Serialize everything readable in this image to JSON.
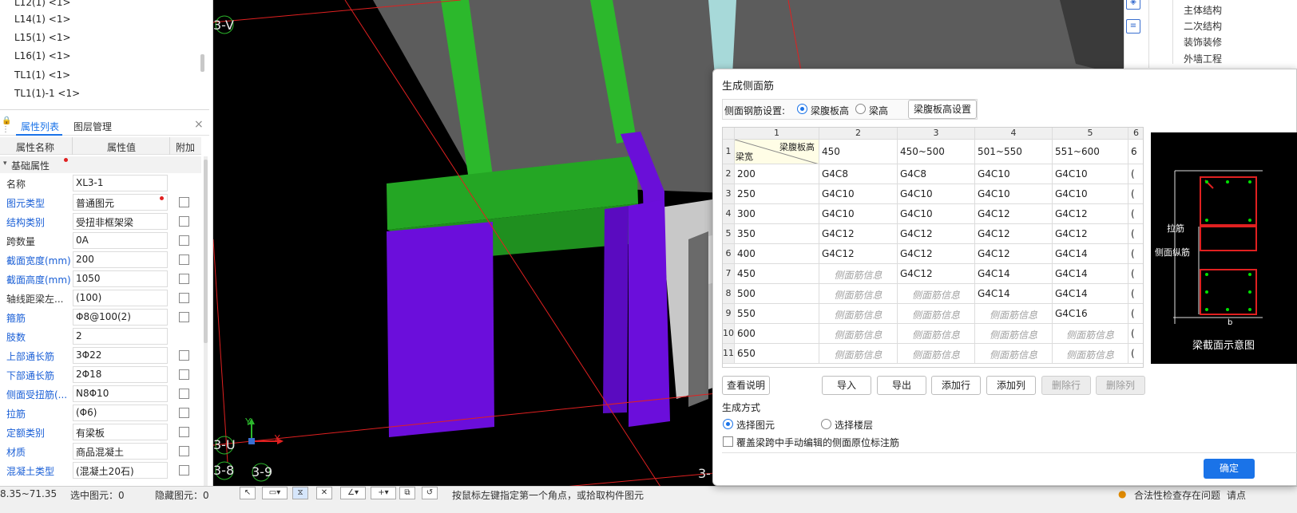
{
  "tree": {
    "items": [
      "L12(1) <1>",
      "L14(1) <1>",
      "L15(1) <1>",
      "L16(1) <1>",
      "TL1(1) <1>",
      "TL1(1)-1 <1>"
    ]
  },
  "props": {
    "tab_list": "属性列表",
    "tab_layers": "图层管理",
    "close": "×",
    "headers": {
      "name": "属性名称",
      "value": "属性值",
      "extra": "附加"
    },
    "group": "基础属性",
    "rows": [
      {
        "name": "名称",
        "value": "XL3-1",
        "blue": false,
        "check": false
      },
      {
        "name": "图元类型",
        "value": "普通图元",
        "blue": true,
        "check": true,
        "dot": true
      },
      {
        "name": "结构类别",
        "value": "受扭非框架梁",
        "blue": true,
        "check": true
      },
      {
        "name": "跨数量",
        "value": "0A",
        "blue": false,
        "check": true
      },
      {
        "name": "截面宽度(mm)",
        "value": "200",
        "blue": true,
        "check": true
      },
      {
        "name": "截面高度(mm)",
        "value": "1050",
        "blue": true,
        "check": true
      },
      {
        "name": "轴线距梁左...",
        "value": "(100)",
        "blue": false,
        "check": true
      },
      {
        "name": "箍筋",
        "value": "Φ8@100(2)",
        "blue": true,
        "check": true
      },
      {
        "name": "肢数",
        "value": "2",
        "blue": true,
        "check": false
      },
      {
        "name": "上部通长筋",
        "value": "3Φ22",
        "blue": true,
        "check": true
      },
      {
        "name": "下部通长筋",
        "value": "2Φ18",
        "blue": true,
        "check": true
      },
      {
        "name": "侧面受扭筋(...",
        "value": "N8Φ10",
        "blue": true,
        "check": true
      },
      {
        "name": "拉筋",
        "value": "(Φ6)",
        "blue": true,
        "check": true
      },
      {
        "name": "定额类别",
        "value": "有梁板",
        "blue": true,
        "check": true
      },
      {
        "name": "材质",
        "value": "商品混凝土",
        "blue": true,
        "check": true
      },
      {
        "name": "混凝土类型",
        "value": "(混凝土20石)",
        "blue": true,
        "check": true
      }
    ]
  },
  "viewport": {
    "axis_labels": [
      "3-V",
      "3-U",
      "3-8",
      "3-9",
      "3-"
    ],
    "coord_axes": {
      "y": "Y",
      "x": "X"
    }
  },
  "status": {
    "coords": "8.35~71.35",
    "selected": "选中图元：0",
    "hidden": "隐藏图元：0",
    "hint": "按鼠标左键指定第一个角点，或拾取构件图元",
    "check": "合法性检查存在问题",
    "more": "请点"
  },
  "rightpanel": {
    "items": [
      "主体结构",
      "二次结构",
      "装饰装修",
      "外墙工程"
    ]
  },
  "dialog": {
    "title": "生成侧面筋",
    "setting_label": "侧面钢筋设置:",
    "opt_web": "梁腹板高",
    "opt_beam": "梁高",
    "web_btn": "梁腹板高设置",
    "col_headers": [
      "1",
      "2",
      "3",
      "4",
      "5",
      "6"
    ],
    "corner_top": "梁腹板高",
    "corner_bottom": "梁宽",
    "grid_rows": [
      {
        "n": "1",
        "c": [
          "450",
          "450~500",
          "501~550",
          "551~600",
          "6"
        ]
      },
      {
        "n": "2",
        "w": "200",
        "c": [
          "G4C8",
          "G4C8",
          "G4C10",
          "G4C10",
          "("
        ]
      },
      {
        "n": "3",
        "w": "250",
        "c": [
          "G4C10",
          "G4C10",
          "G4C10",
          "G4C10",
          "("
        ]
      },
      {
        "n": "4",
        "w": "300",
        "c": [
          "G4C10",
          "G4C10",
          "G4C12",
          "G4C12",
          "("
        ]
      },
      {
        "n": "5",
        "w": "350",
        "c": [
          "G4C12",
          "G4C12",
          "G4C12",
          "G4C12",
          "("
        ]
      },
      {
        "n": "6",
        "w": "400",
        "c": [
          "G4C12",
          "G4C12",
          "G4C12",
          "G4C14",
          "("
        ]
      },
      {
        "n": "7",
        "w": "450",
        "c": [
          "侧面筋信息",
          "G4C12",
          "G4C14",
          "G4C14",
          "("
        ]
      },
      {
        "n": "8",
        "w": "500",
        "c": [
          "侧面筋信息",
          "侧面筋信息",
          "G4C14",
          "G4C14",
          "("
        ]
      },
      {
        "n": "9",
        "w": "550",
        "c": [
          "侧面筋信息",
          "侧面筋信息",
          "侧面筋信息",
          "G4C16",
          "("
        ]
      },
      {
        "n": "10",
        "w": "600",
        "c": [
          "侧面筋信息",
          "侧面筋信息",
          "侧面筋信息",
          "侧面筋信息",
          "("
        ]
      },
      {
        "n": "11",
        "w": "650",
        "c": [
          "侧面筋信息",
          "侧面筋信息",
          "侧面筋信息",
          "侧面筋信息",
          "("
        ]
      }
    ],
    "btn_view": "查看说明",
    "btn_import": "导入",
    "btn_export": "导出",
    "btn_addrow": "添加行",
    "btn_addcol": "添加列",
    "btn_delrow": "删除行",
    "btn_delcol": "删除列",
    "gen_label": "生成方式",
    "gen_opt1": "选择图元",
    "gen_opt2": "选择楼层",
    "overwrite": "覆盖梁跨中手动编辑的侧面原位标注筋",
    "ok": "确定",
    "preview": {
      "tie": "拉筋",
      "side": "侧面纵筋",
      "b": "b",
      "caption": "梁截面示意图"
    }
  }
}
